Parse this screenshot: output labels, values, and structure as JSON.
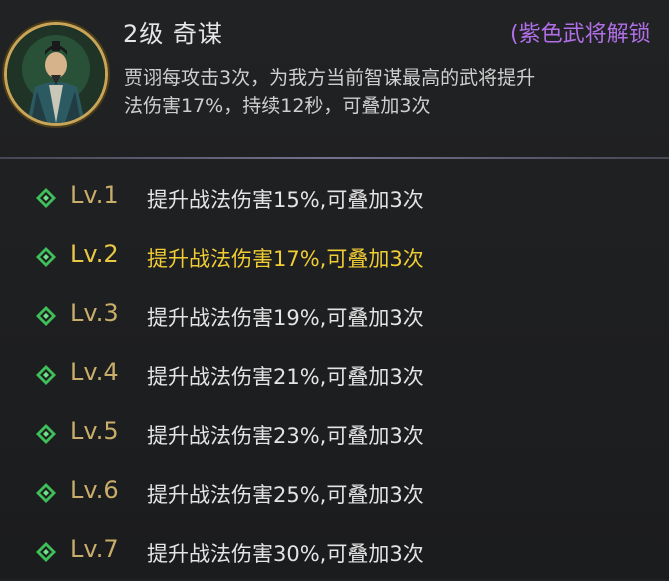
{
  "header": {
    "title": "2级 奇谋",
    "unlock_note": "(紫色武将解锁",
    "description_line1": "贾诩每攻击3次，为我方当前智谋最高的武将提升",
    "description_line2": "法伤害17%，持续12秒，可叠加3次"
  },
  "colors": {
    "accent_gold": "#c9ad6a",
    "active_yellow": "#f0cc35",
    "purple": "#b06fe6",
    "gem_green": "#3fbf5a"
  },
  "levels": [
    {
      "label": "Lv.1",
      "text": "提升战法伤害15%,可叠加3次",
      "active": false
    },
    {
      "label": "Lv.2",
      "text": "提升战法伤害17%,可叠加3次",
      "active": true
    },
    {
      "label": "Lv.3",
      "text": "提升战法伤害19%,可叠加3次",
      "active": false
    },
    {
      "label": "Lv.4",
      "text": "提升战法伤害21%,可叠加3次",
      "active": false
    },
    {
      "label": "Lv.5",
      "text": "提升战法伤害23%,可叠加3次",
      "active": false
    },
    {
      "label": "Lv.6",
      "text": "提升战法伤害25%,可叠加3次",
      "active": false
    },
    {
      "label": "Lv.7",
      "text": "提升战法伤害30%,可叠加3次",
      "active": false
    }
  ]
}
